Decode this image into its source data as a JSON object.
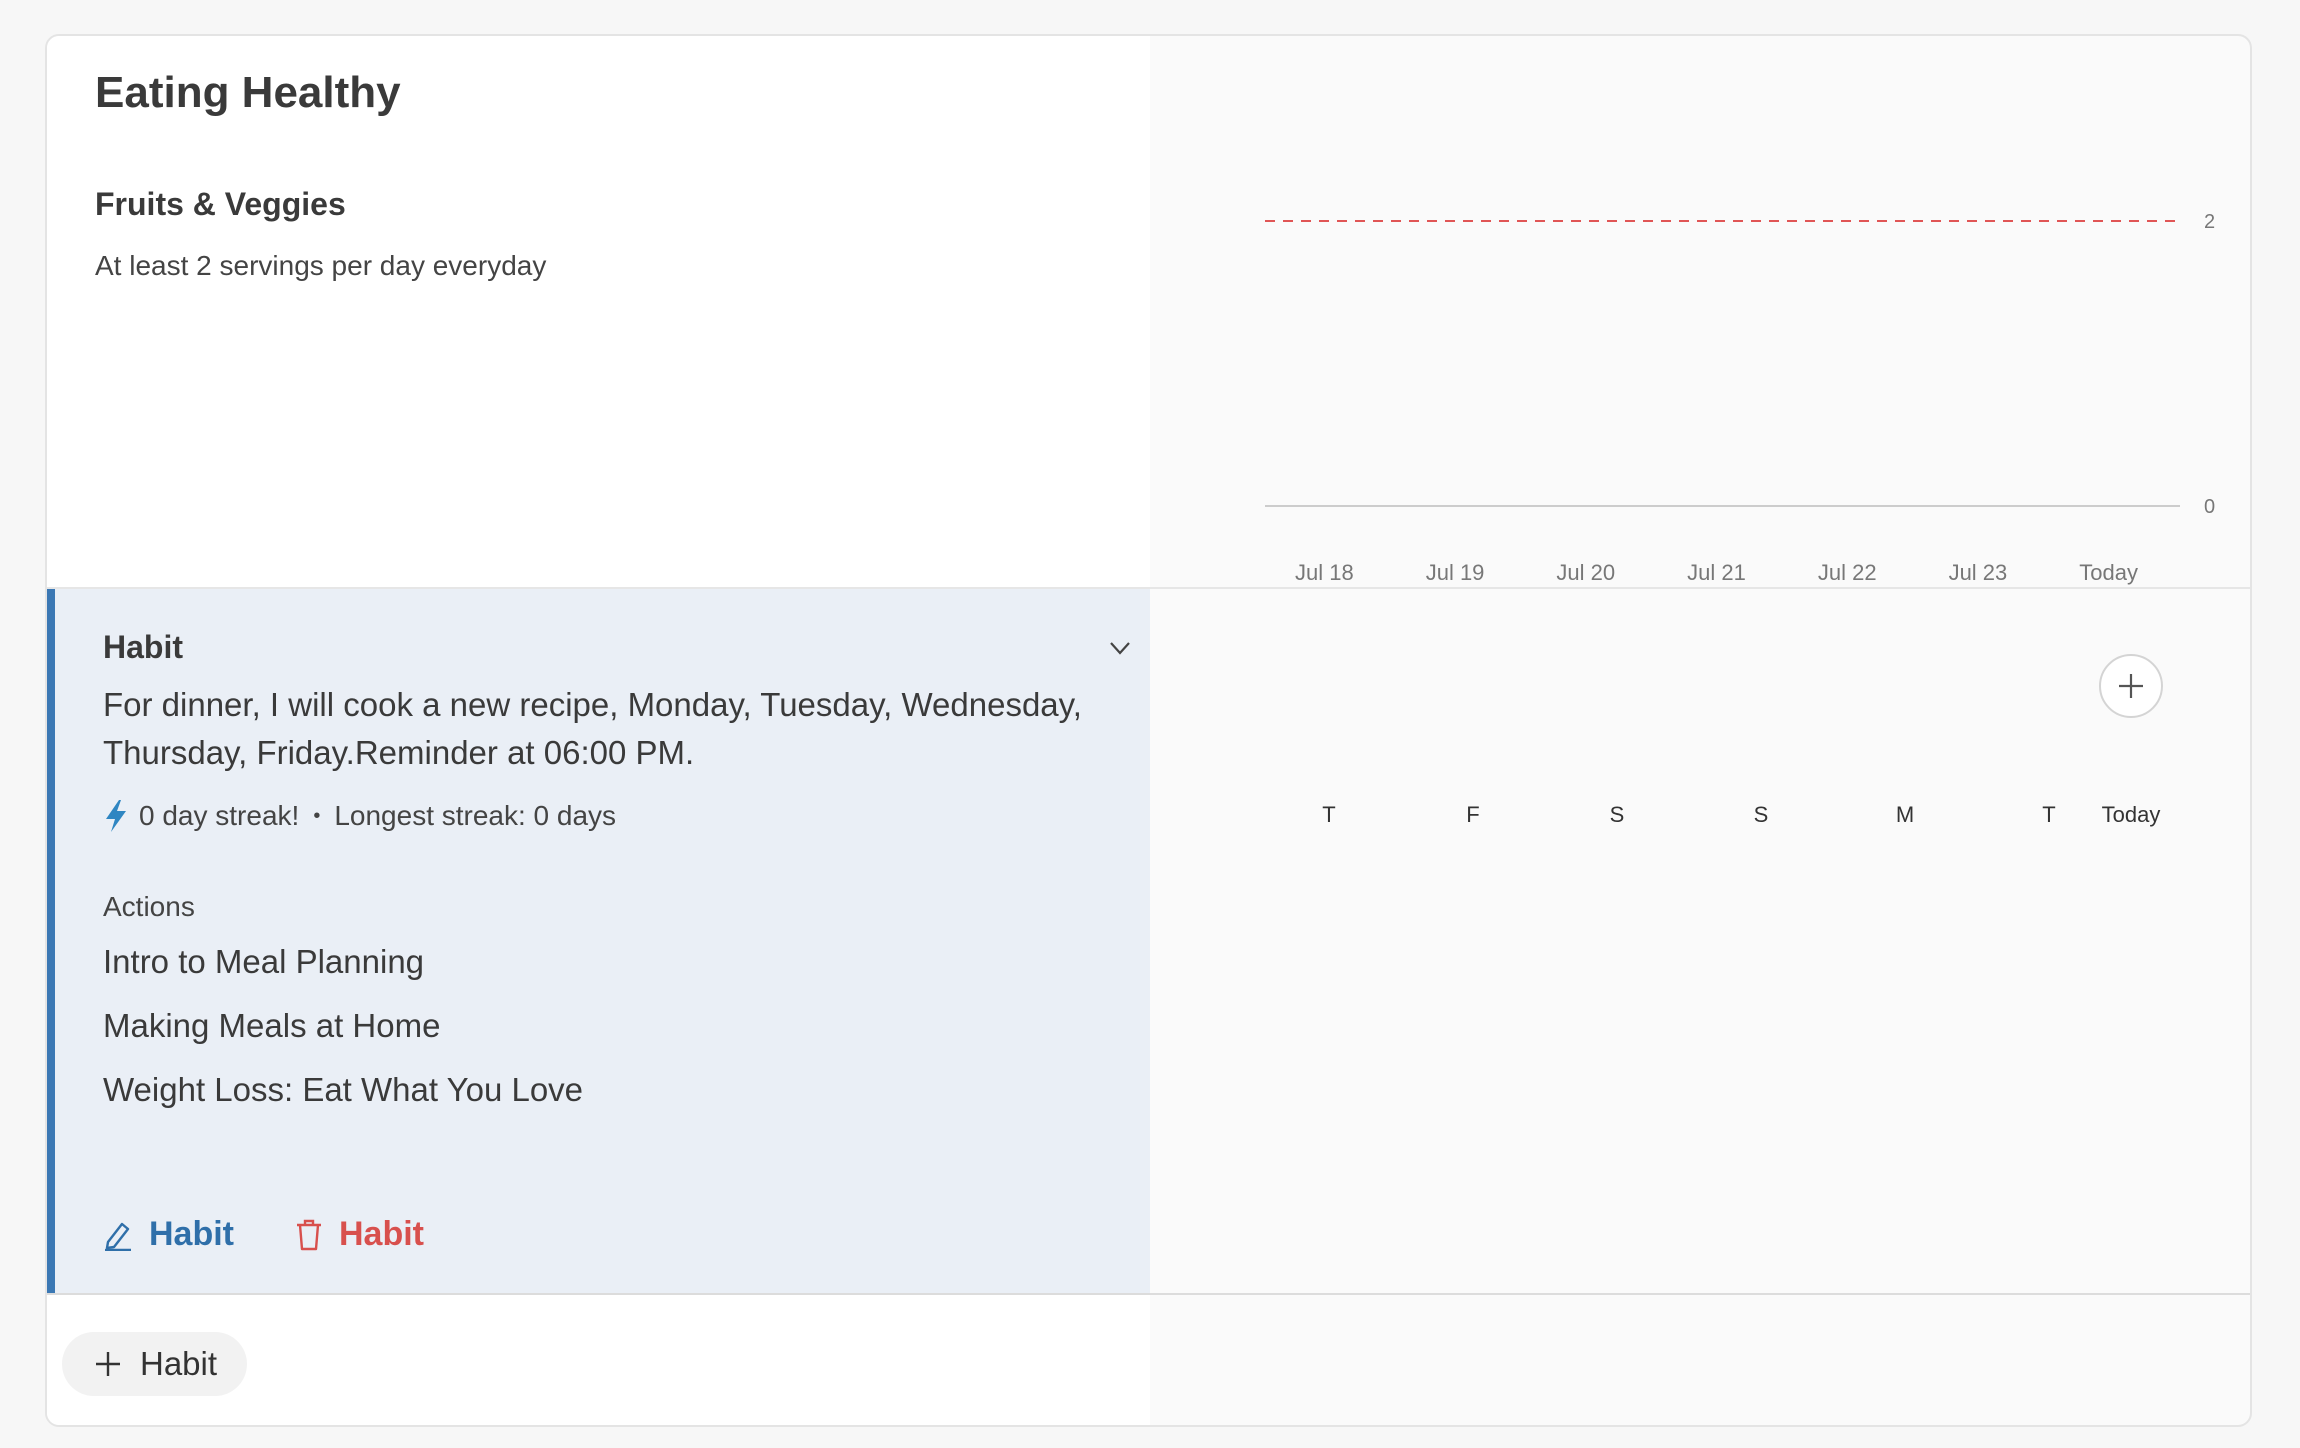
{
  "goal": {
    "title": "Eating Healthy",
    "subtitle": "Fruits & Veggies",
    "description": "At least 2 servings per day everyday"
  },
  "chart_data": {
    "type": "line",
    "categories": [
      "Jul 18",
      "Jul 19",
      "Jul 20",
      "Jul 21",
      "Jul 22",
      "Jul 23",
      "Today"
    ],
    "series": [],
    "target": 2,
    "yticks": [
      "2",
      "0"
    ],
    "ylim": [
      0,
      2
    ],
    "colors": {
      "target_line": "#e05555",
      "axis": "#cccccc"
    }
  },
  "habit": {
    "label": "Habit",
    "description": "For dinner, I will cook a new recipe, Monday, Tuesday, Wednesday, Thursday, Friday.Reminder at 06:00 PM.",
    "streak": "0 day streak!",
    "longest_streak": "Longest streak: 0 days",
    "actions_label": "Actions",
    "actions": [
      "Intro to Meal Planning",
      "Making Meals at Home",
      "Weight Loss: Eat What You Love"
    ],
    "edit_label": "Habit",
    "delete_label": "Habit",
    "add_label": "Habit"
  },
  "tracker": {
    "days": [
      "T",
      "F",
      "S",
      "S",
      "M",
      "T",
      "Today"
    ]
  },
  "colors": {
    "accent": "#3b78b4",
    "danger": "#d8504d",
    "habit_bg": "#eaeff6"
  }
}
